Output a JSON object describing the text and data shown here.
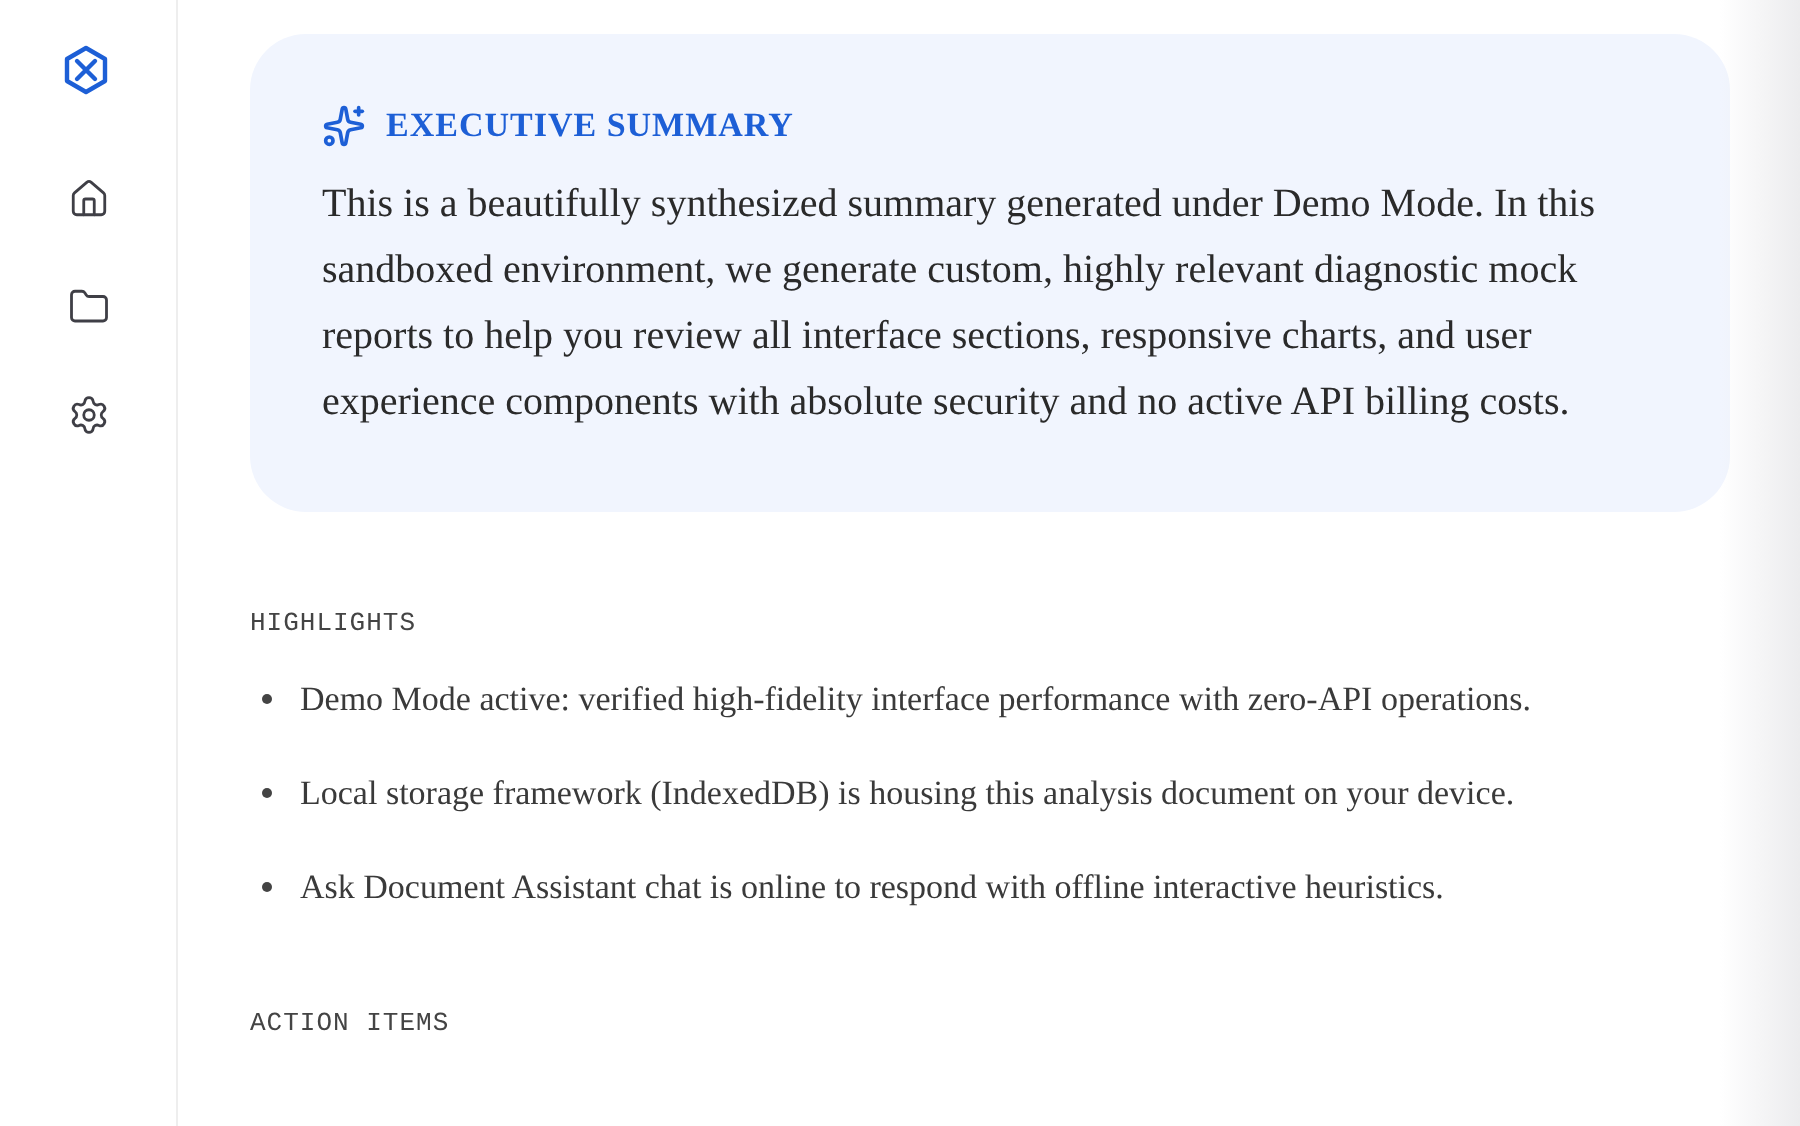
{
  "sidebar": {
    "items": [
      {
        "kind": "home"
      },
      {
        "kind": "folder"
      },
      {
        "kind": "settings"
      }
    ]
  },
  "summary": {
    "title": "EXECUTIVE SUMMARY",
    "text": "This is a beautifully synthesized summary generated under Demo Mode. In this sandboxed environment, we generate custom, highly relevant diagnostic mock reports to help you review all interface sections, responsive charts, and user experience components with absolute security and no active API billing costs."
  },
  "highlights": {
    "heading": "HIGHLIGHTS",
    "items": [
      "Demo Mode active: verified high-fidelity interface performance with zero-API operations.",
      "Local storage framework (IndexedDB) is housing this analysis document on your device.",
      "Ask Document Assistant chat is online to respond with offline interactive heuristics."
    ]
  },
  "action_items": {
    "heading": "ACTION ITEMS"
  }
}
